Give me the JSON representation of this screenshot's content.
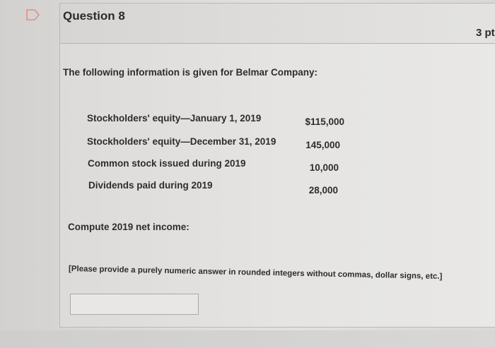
{
  "question": {
    "title": "Question 8",
    "points": "3 pt"
  },
  "content": {
    "intro": "The following information is given for Belmar Company:",
    "rows": [
      {
        "label": "Stockholders' equity—January 1, 2019",
        "value": "$115,000"
      },
      {
        "label": "Stockholders' equity—December 31, 2019",
        "value": "145,000"
      },
      {
        "label": "Common stock issued during 2019",
        "value": "10,000"
      },
      {
        "label": "Dividends paid during 2019",
        "value": "28,000"
      }
    ],
    "prompt": "Compute 2019 net income:",
    "instruction": "[Please provide a purely numeric answer in rounded integers without commas, dollar signs, etc.]"
  },
  "answer": {
    "value": "",
    "placeholder": ""
  },
  "icons": {
    "flag": "flag-icon"
  },
  "colors": {
    "flag_accent": "#e98a8a"
  }
}
